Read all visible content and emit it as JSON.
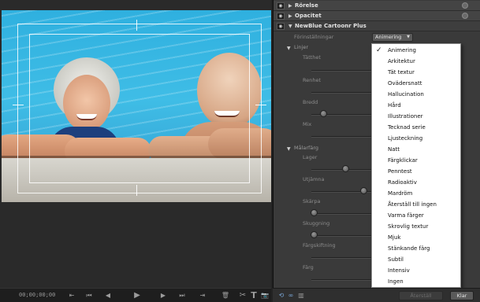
{
  "monitor": {
    "timecode": "00;00;00;00",
    "controls": {
      "step_back_to_in": "⇤",
      "rewind": "⏮",
      "step_back": "◀",
      "play": "▶",
      "step_forward": "▶",
      "fast_forward": "⏭",
      "step_to_out": "⇥",
      "trash": "🗑",
      "cut": "✂",
      "title": "T",
      "snapshot": "📷"
    }
  },
  "effects_panel": {
    "rows": [
      {
        "label": "Rörelse"
      },
      {
        "label": "Opacitet"
      },
      {
        "label": "NewBlue Cartoonr Plus"
      }
    ],
    "presets_label": "Förinställningar",
    "presets_value": "Animering",
    "groups": [
      {
        "label": "Linjer",
        "params": [
          "Tätthet",
          "Renhet",
          "Bredd",
          "Mix"
        ]
      },
      {
        "label": "Målarfärg",
        "params": [
          "Lager",
          "Utjämna",
          "Skärpa",
          "Skuggning",
          "Färgskiftning",
          "Färg"
        ]
      }
    ],
    "slider_levels": {
      "Bredd": 0.12,
      "Lager": 0.4,
      "Utjämna": 0.62,
      "Skärpa": 0.04,
      "Skuggning": 0.04
    },
    "footer": {
      "reset_label": "Återställ",
      "done_label": "Klar"
    }
  },
  "preset_menu": {
    "selected": "Animering",
    "items": [
      "Animering",
      "Arkitektur",
      "Tät textur",
      "Ovädersnatt",
      "Hallucination",
      "Hård",
      "Illustrationer",
      "Tecknad serie",
      "Ljusteckning",
      "Natt",
      "Färgklickar",
      "Penntest",
      "Radioaktiv",
      "Mardröm",
      "Återställ till ingen",
      "Varma färger",
      "Skrovlig textur",
      "Mjuk",
      "Stänkande färg",
      "Subtil",
      "Intensiv",
      "Ingen"
    ]
  },
  "colors": {
    "panel_bg": "#3a3a3a",
    "menu_bg": "#ffffff",
    "pool_water": "#3fbde6"
  }
}
